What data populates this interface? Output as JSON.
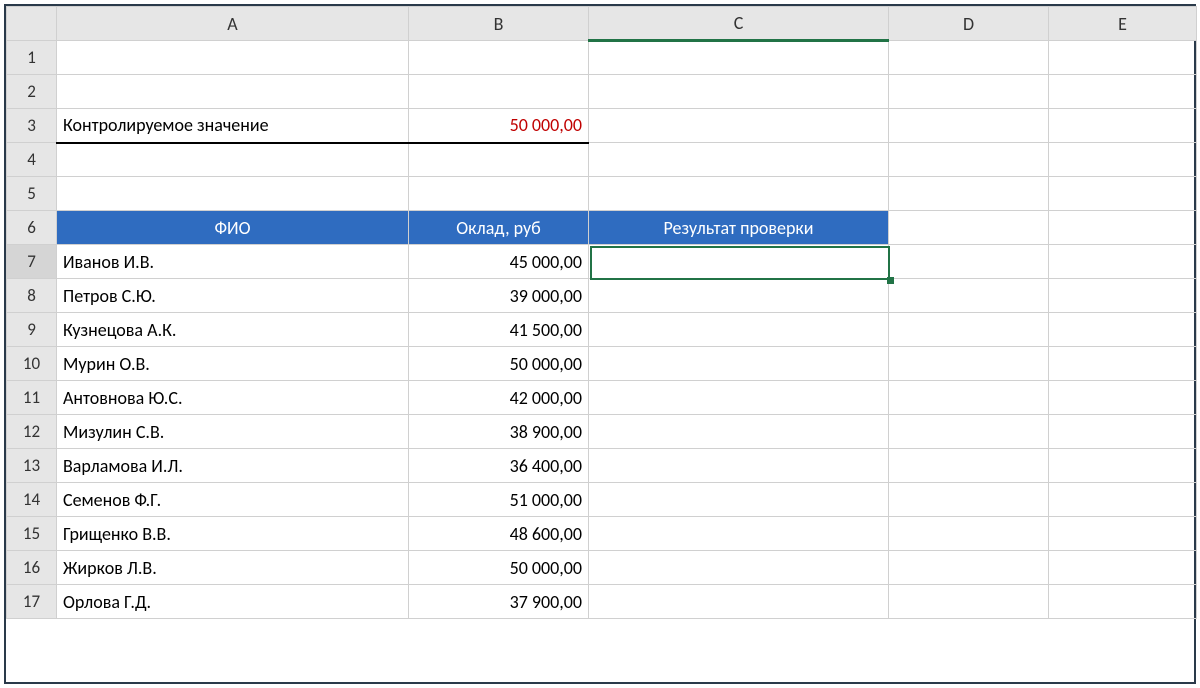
{
  "columns": [
    "A",
    "B",
    "C",
    "D",
    "E"
  ],
  "row_count": 17,
  "active_cell": "C7",
  "row3": {
    "label": "Контролируемое значение",
    "value": "50 000,00"
  },
  "headers": {
    "fio": "ФИО",
    "salary": "Оклад, руб",
    "result": "Результат проверки"
  },
  "rows": [
    {
      "n": 7,
      "name": "Иванов И.В.",
      "salary": "45 000,00"
    },
    {
      "n": 8,
      "name": "Петров С.Ю.",
      "salary": "39 000,00"
    },
    {
      "n": 9,
      "name": "Кузнецова А.К.",
      "salary": "41 500,00"
    },
    {
      "n": 10,
      "name": "Мурин О.В.",
      "salary": "50 000,00"
    },
    {
      "n": 11,
      "name": "Антовнова Ю.С.",
      "salary": "42 000,00"
    },
    {
      "n": 12,
      "name": "Мизулин С.В.",
      "salary": "38 900,00"
    },
    {
      "n": 13,
      "name": "Варламова И.Л.",
      "salary": "36 400,00"
    },
    {
      "n": 14,
      "name": "Семенов Ф.Г.",
      "salary": "51 000,00"
    },
    {
      "n": 15,
      "name": "Грищенко В.В.",
      "salary": "48 600,00"
    },
    {
      "n": 16,
      "name": "Жирков Л.В.",
      "salary": "50 000,00"
    },
    {
      "n": 17,
      "name": "Орлова Г.Д.",
      "salary": "37 900,00"
    }
  ]
}
